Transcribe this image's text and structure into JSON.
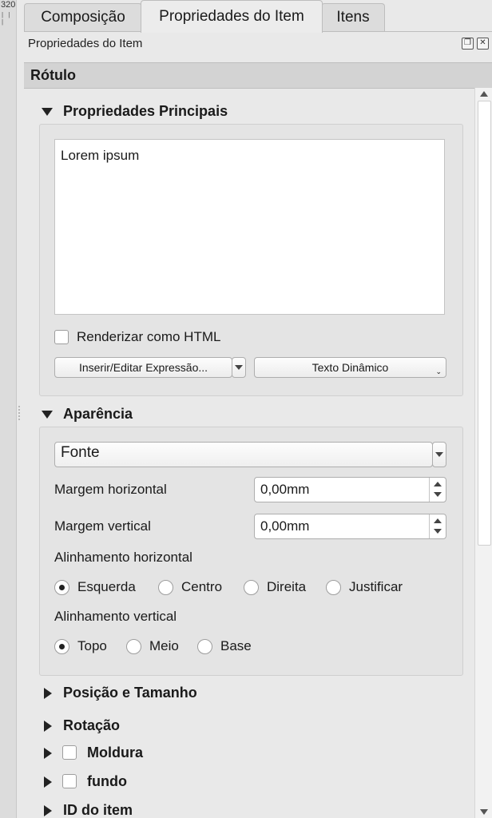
{
  "ruler": {
    "number": "320"
  },
  "tabs": [
    {
      "label": "Composição",
      "active": false
    },
    {
      "label": "Propriedades do Item",
      "active": true
    },
    {
      "label": "Itens",
      "active": false
    }
  ],
  "panel": {
    "title": "Propriedades do Item",
    "section": "Rótulo"
  },
  "main_props": {
    "header": "Propriedades Principais",
    "text": "Lorem ipsum",
    "render_html": {
      "label": "Renderizar como HTML",
      "checked": false
    },
    "insert_expression": "Inserir/Editar Expressão...",
    "dynamic_text": "Texto Dinâmico"
  },
  "appearance": {
    "header": "Aparência",
    "font_button": "Fonte",
    "margin_h": {
      "label": "Margem horizontal",
      "value": "0,00mm"
    },
    "margin_v": {
      "label": "Margem vertical",
      "value": "0,00mm"
    },
    "align_h": {
      "label": "Alinhamento horizontal",
      "options": [
        "Esquerda",
        "Centro",
        "Direita",
        "Justificar"
      ],
      "selected": "Esquerda"
    },
    "align_v": {
      "label": "Alinhamento vertical",
      "options": [
        "Topo",
        "Meio",
        "Base"
      ],
      "selected": "Topo"
    }
  },
  "collapsed_groups": [
    {
      "label": "Posição e Tamanho",
      "checkbox": false
    },
    {
      "label": "Rotação",
      "checkbox": false
    },
    {
      "label": "Moldura",
      "checkbox": true
    },
    {
      "label": "fundo",
      "checkbox": true
    },
    {
      "label": "ID do item",
      "checkbox": false
    }
  ]
}
